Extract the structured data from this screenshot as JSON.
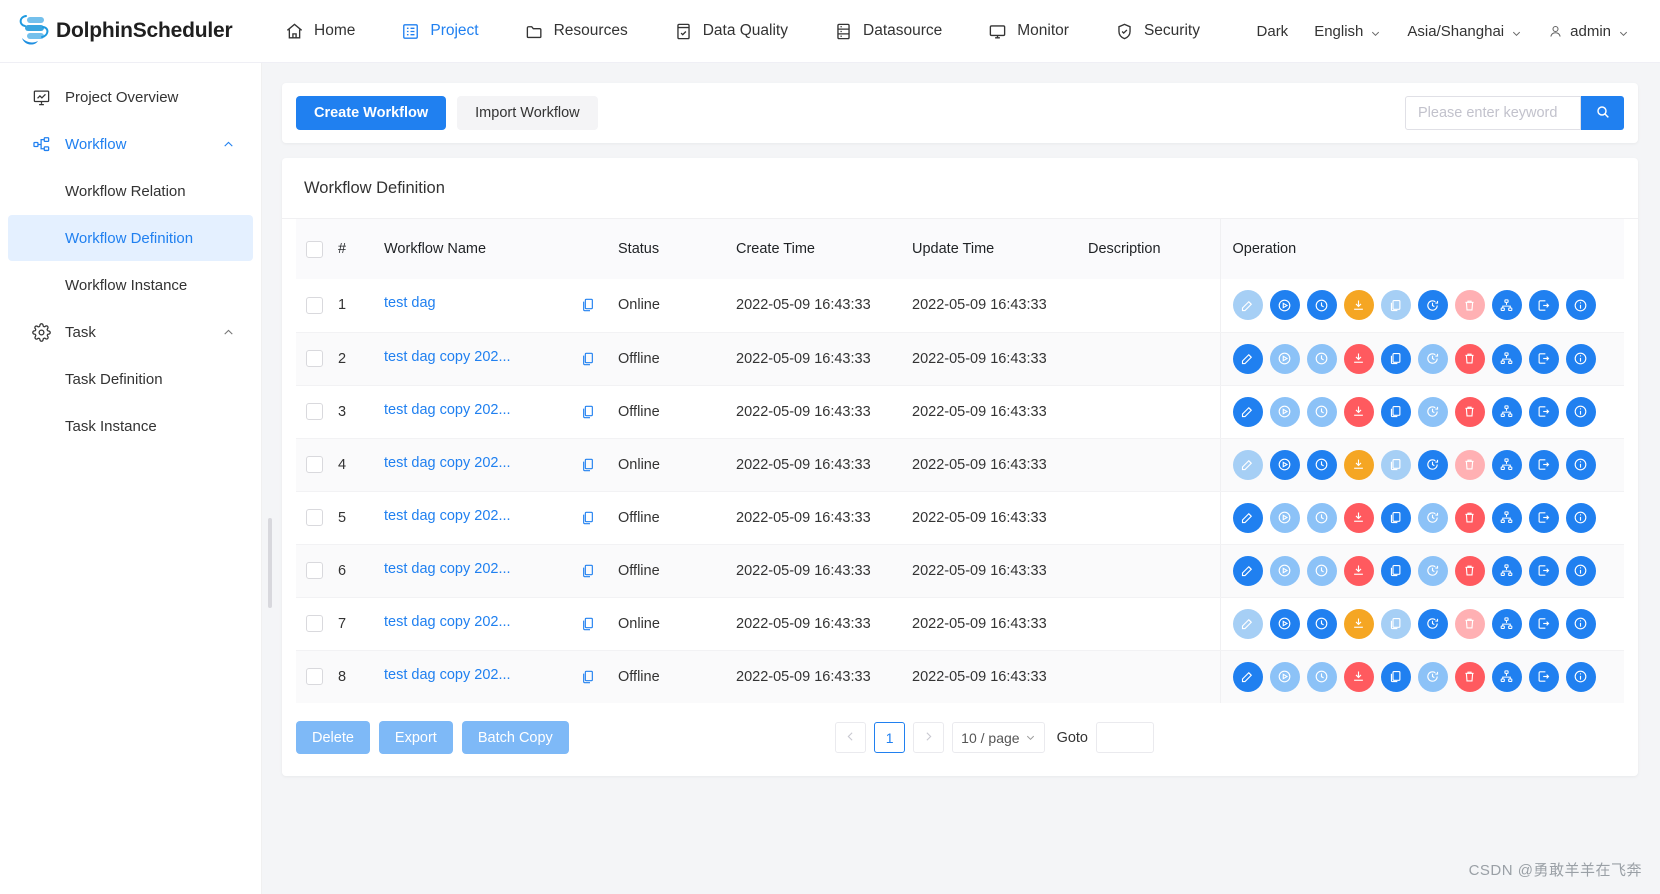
{
  "brand": {
    "name": "DolphinScheduler",
    "logo_icon": "dolphin-logo-icon"
  },
  "topnav": {
    "items": [
      {
        "label": "Home",
        "icon": "home-icon",
        "active": false
      },
      {
        "label": "Project",
        "icon": "project-icon",
        "active": true
      },
      {
        "label": "Resources",
        "icon": "folder-icon",
        "active": false
      },
      {
        "label": "Data Quality",
        "icon": "data-quality-icon",
        "active": false
      },
      {
        "label": "Datasource",
        "icon": "database-icon",
        "active": false
      },
      {
        "label": "Monitor",
        "icon": "monitor-icon",
        "active": false
      },
      {
        "label": "Security",
        "icon": "shield-icon",
        "active": false
      }
    ],
    "right": {
      "theme": "Dark",
      "language": "English",
      "timezone": "Asia/Shanghai",
      "user": "admin"
    }
  },
  "sidebar": {
    "items": [
      {
        "label": "Project Overview",
        "icon": "overview-icon",
        "level": "top",
        "state": "normal"
      },
      {
        "label": "Workflow",
        "icon": "workflow-icon",
        "level": "top",
        "state": "expanded"
      },
      {
        "label": "Workflow Relation",
        "level": "child",
        "state": "normal"
      },
      {
        "label": "Workflow Definition",
        "level": "child",
        "state": "selected"
      },
      {
        "label": "Workflow Instance",
        "level": "child",
        "state": "normal"
      },
      {
        "label": "Task",
        "icon": "gear-icon",
        "level": "top",
        "state": "expanded"
      },
      {
        "label": "Task Definition",
        "level": "child",
        "state": "normal"
      },
      {
        "label": "Task Instance",
        "level": "child",
        "state": "normal"
      }
    ]
  },
  "toolbar": {
    "create_label": "Create Workflow",
    "import_label": "Import Workflow",
    "search_placeholder": "Please enter keyword",
    "search_value": "",
    "search_icon": "search-icon"
  },
  "panel": {
    "title": "Workflow Definition"
  },
  "table": {
    "columns": [
      "#",
      "Workflow Name",
      "Status",
      "Create Time",
      "Update Time",
      "Description",
      "Operation"
    ],
    "rows": [
      {
        "idx": "1",
        "name": "test dag",
        "status": "Online",
        "create_time": "2022-05-09 16:43:33",
        "update_time": "2022-05-09 16:43:33",
        "description": "",
        "ops_state": "online"
      },
      {
        "idx": "2",
        "name": "test dag copy 202...",
        "status": "Offline",
        "create_time": "2022-05-09 16:43:33",
        "update_time": "2022-05-09 16:43:33",
        "description": "",
        "ops_state": "offline"
      },
      {
        "idx": "3",
        "name": "test dag copy 202...",
        "status": "Offline",
        "create_time": "2022-05-09 16:43:33",
        "update_time": "2022-05-09 16:43:33",
        "description": "",
        "ops_state": "offline"
      },
      {
        "idx": "4",
        "name": "test dag copy 202...",
        "status": "Online",
        "create_time": "2022-05-09 16:43:33",
        "update_time": "2022-05-09 16:43:33",
        "description": "",
        "ops_state": "online"
      },
      {
        "idx": "5",
        "name": "test dag copy 202...",
        "status": "Offline",
        "create_time": "2022-05-09 16:43:33",
        "update_time": "2022-05-09 16:43:33",
        "description": "",
        "ops_state": "offline"
      },
      {
        "idx": "6",
        "name": "test dag copy 202...",
        "status": "Offline",
        "create_time": "2022-05-09 16:43:33",
        "update_time": "2022-05-09 16:43:33",
        "description": "",
        "ops_state": "offline"
      },
      {
        "idx": "7",
        "name": "test dag copy 202...",
        "status": "Online",
        "create_time": "2022-05-09 16:43:33",
        "update_time": "2022-05-09 16:43:33",
        "description": "",
        "ops_state": "online"
      },
      {
        "idx": "8",
        "name": "test dag copy 202...",
        "status": "Offline",
        "create_time": "2022-05-09 16:43:33",
        "update_time": "2022-05-09 16:43:33",
        "description": "",
        "ops_state": "offline"
      }
    ],
    "operation_icons": [
      "edit-icon",
      "start-icon",
      "timing-icon",
      "up-down-line-icon",
      "copy-icon",
      "cron-manage-icon",
      "delete-icon",
      "tree-view-icon",
      "export-icon",
      "version-info-icon"
    ]
  },
  "footer": {
    "delete_label": "Delete",
    "export_label": "Export",
    "batch_copy_label": "Batch Copy",
    "prev_label": "‹",
    "next_label": "›",
    "current_page": "1",
    "page_size": "10 / page",
    "goto_label": "Goto",
    "goto_value": ""
  },
  "watermark": "CSDN @勇敢羊羊在飞奔",
  "colors": {
    "accent": "#2080f0",
    "accent_light": "#8cc2f7",
    "selected_bg": "#e4f0ff",
    "orange": "#f5a623",
    "red": "#ff5a5f",
    "red_light": "#ffb0b3",
    "text": "#333333"
  }
}
